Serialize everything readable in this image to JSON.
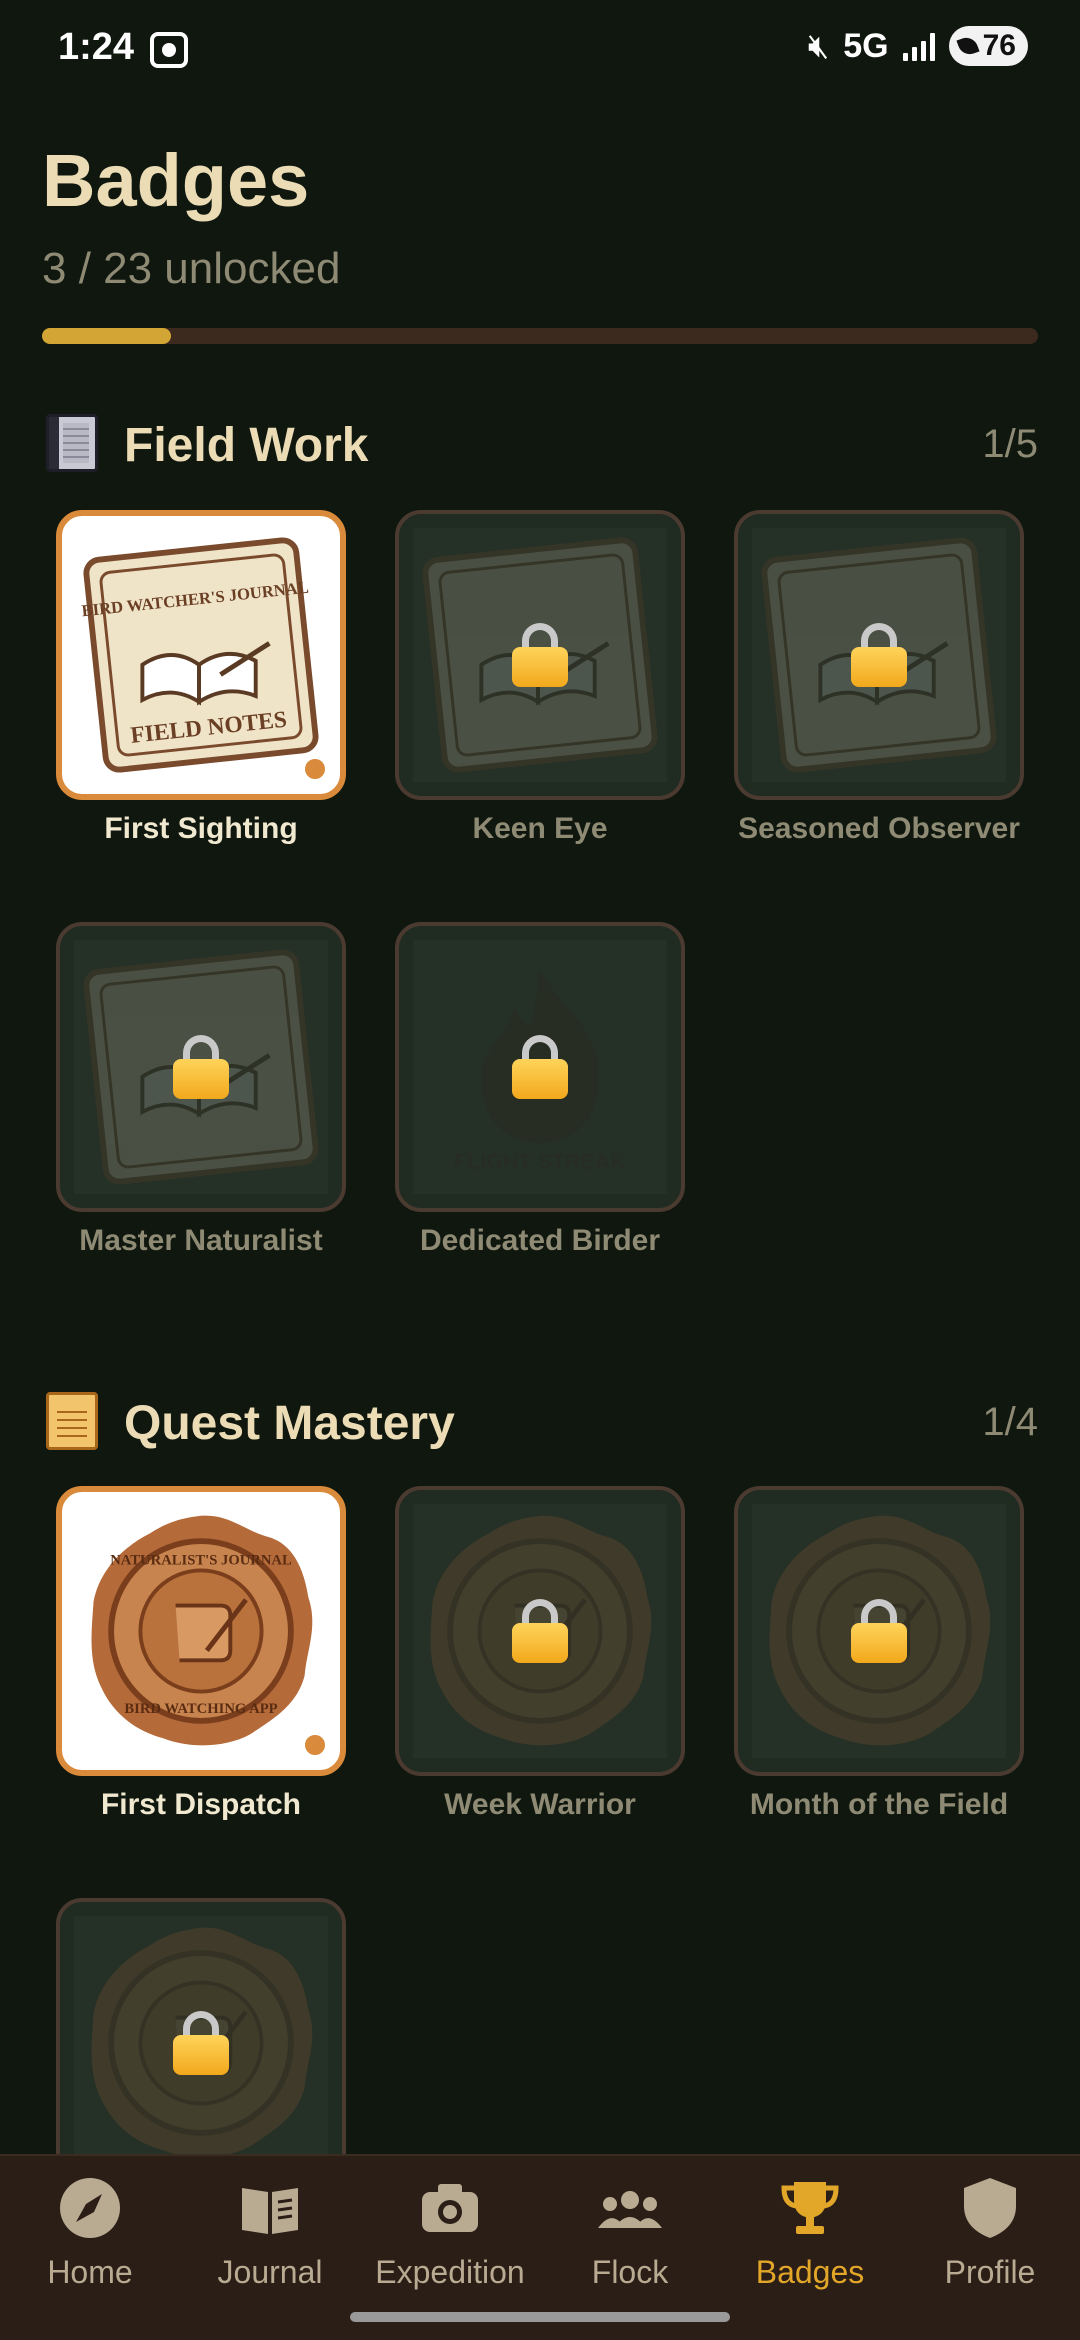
{
  "status_bar": {
    "time": "1:24",
    "network": "5G",
    "battery": "76",
    "icons": [
      "screenshot-icon",
      "mute-icon",
      "signal-icon",
      "leaf-icon"
    ]
  },
  "header": {
    "title": "Badges",
    "summary": "3 / 23 unlocked",
    "progress_fraction": 0.13
  },
  "sections": [
    {
      "title": "Field Work",
      "count": "1/5",
      "icon": "notebook-icon",
      "badges": [
        {
          "label": "First Sighting",
          "locked": false,
          "art": "field-notes",
          "art_text": [
            "BIRD WATCHER'S JOURNAL",
            "FIELD NOTES"
          ]
        },
        {
          "label": "Keen Eye",
          "locked": true,
          "art": "field-notes"
        },
        {
          "label": "Seasoned Observer",
          "locked": true,
          "art": "field-notes"
        },
        {
          "label": "Master Naturalist",
          "locked": true,
          "art": "field-notes"
        },
        {
          "label": "Dedicated Birder",
          "locked": true,
          "art": "flame",
          "art_text": [
            "FLIGHT STREAK"
          ]
        }
      ]
    },
    {
      "title": "Quest Mastery",
      "count": "1/4",
      "icon": "scroll-icon",
      "badges": [
        {
          "label": "First Dispatch",
          "locked": false,
          "art": "wax-seal",
          "art_text": [
            "NATURALIST'S JOURNAL",
            "BIRD WATCHING APP"
          ]
        },
        {
          "label": "Week Warrior",
          "locked": true,
          "art": "wax-seal"
        },
        {
          "label": "Month of the Field",
          "locked": true,
          "art": "wax-seal"
        },
        {
          "label": "",
          "locked": true,
          "art": "wax-seal"
        }
      ]
    }
  ],
  "bottom_nav": {
    "items": [
      {
        "label": "Home",
        "icon": "compass-icon",
        "active": false
      },
      {
        "label": "Journal",
        "icon": "book-icon",
        "active": false
      },
      {
        "label": "Expedition",
        "icon": "camera-icon",
        "active": false
      },
      {
        "label": "Flock",
        "icon": "group-icon",
        "active": false
      },
      {
        "label": "Badges",
        "icon": "trophy-icon",
        "active": true
      },
      {
        "label": "Profile",
        "icon": "shield-icon",
        "active": false
      }
    ]
  },
  "colors": {
    "background": "#0f170f",
    "accent": "#d98a3a",
    "gold": "#d2a535",
    "nav_active": "#e2a628"
  }
}
